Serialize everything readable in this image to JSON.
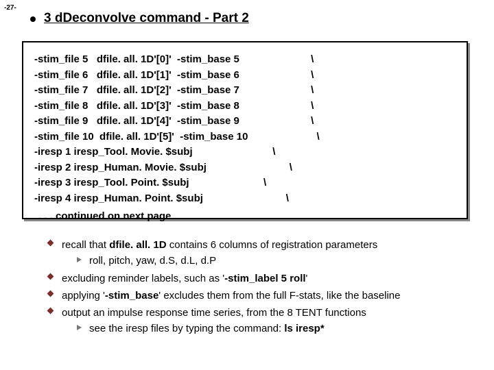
{
  "page_number": "-27-",
  "title": "3 dDeconvolve command - Part 2",
  "code_lines": [
    "-stim_file 5   dfile. all. 1D'[0]'  -stim_base 5                         \\",
    "-stim_file 6   dfile. all. 1D'[1]'  -stim_base 6                         \\",
    "-stim_file 7   dfile. all. 1D'[2]'  -stim_base 7                         \\",
    "-stim_file 8   dfile. all. 1D'[3]'  -stim_base 8                         \\",
    "-stim_file 9   dfile. all. 1D'[4]'  -stim_base 9                         \\",
    "-stim_file 10  dfile. all. 1D'[5]'  -stim_base 10                        \\",
    "-iresp 1 iresp_Tool. Movie. $subj                            \\",
    "-iresp 2 iresp_Human. Movie. $subj                             \\",
    "-iresp 3 iresp_Tool. Point. $subj                          \\",
    "-iresp 4 iresp_Human. Point. $subj                             \\"
  ],
  "continued": ". . . continued on next page",
  "notes": {
    "n1_pre": "recall that ",
    "n1_b": "dfile. all. 1D",
    "n1_post": " contains 6 columns of registration parameters",
    "n1_sub": "roll, pitch, yaw, d.S, d.L, d.P",
    "n2_pre": "excluding reminder labels, such as '",
    "n2_b": "-stim_label 5 roll",
    "n2_post": "'",
    "n3_pre": "applying '",
    "n3_b": "-stim_base",
    "n3_post": "' excludes them from the full F-stats, like the baseline",
    "n4": "output an impulse response time series, from the  8 TENT functions",
    "n4_sub_pre": "see the iresp files by typing the command:  ",
    "n4_sub_b": "ls iresp*"
  }
}
